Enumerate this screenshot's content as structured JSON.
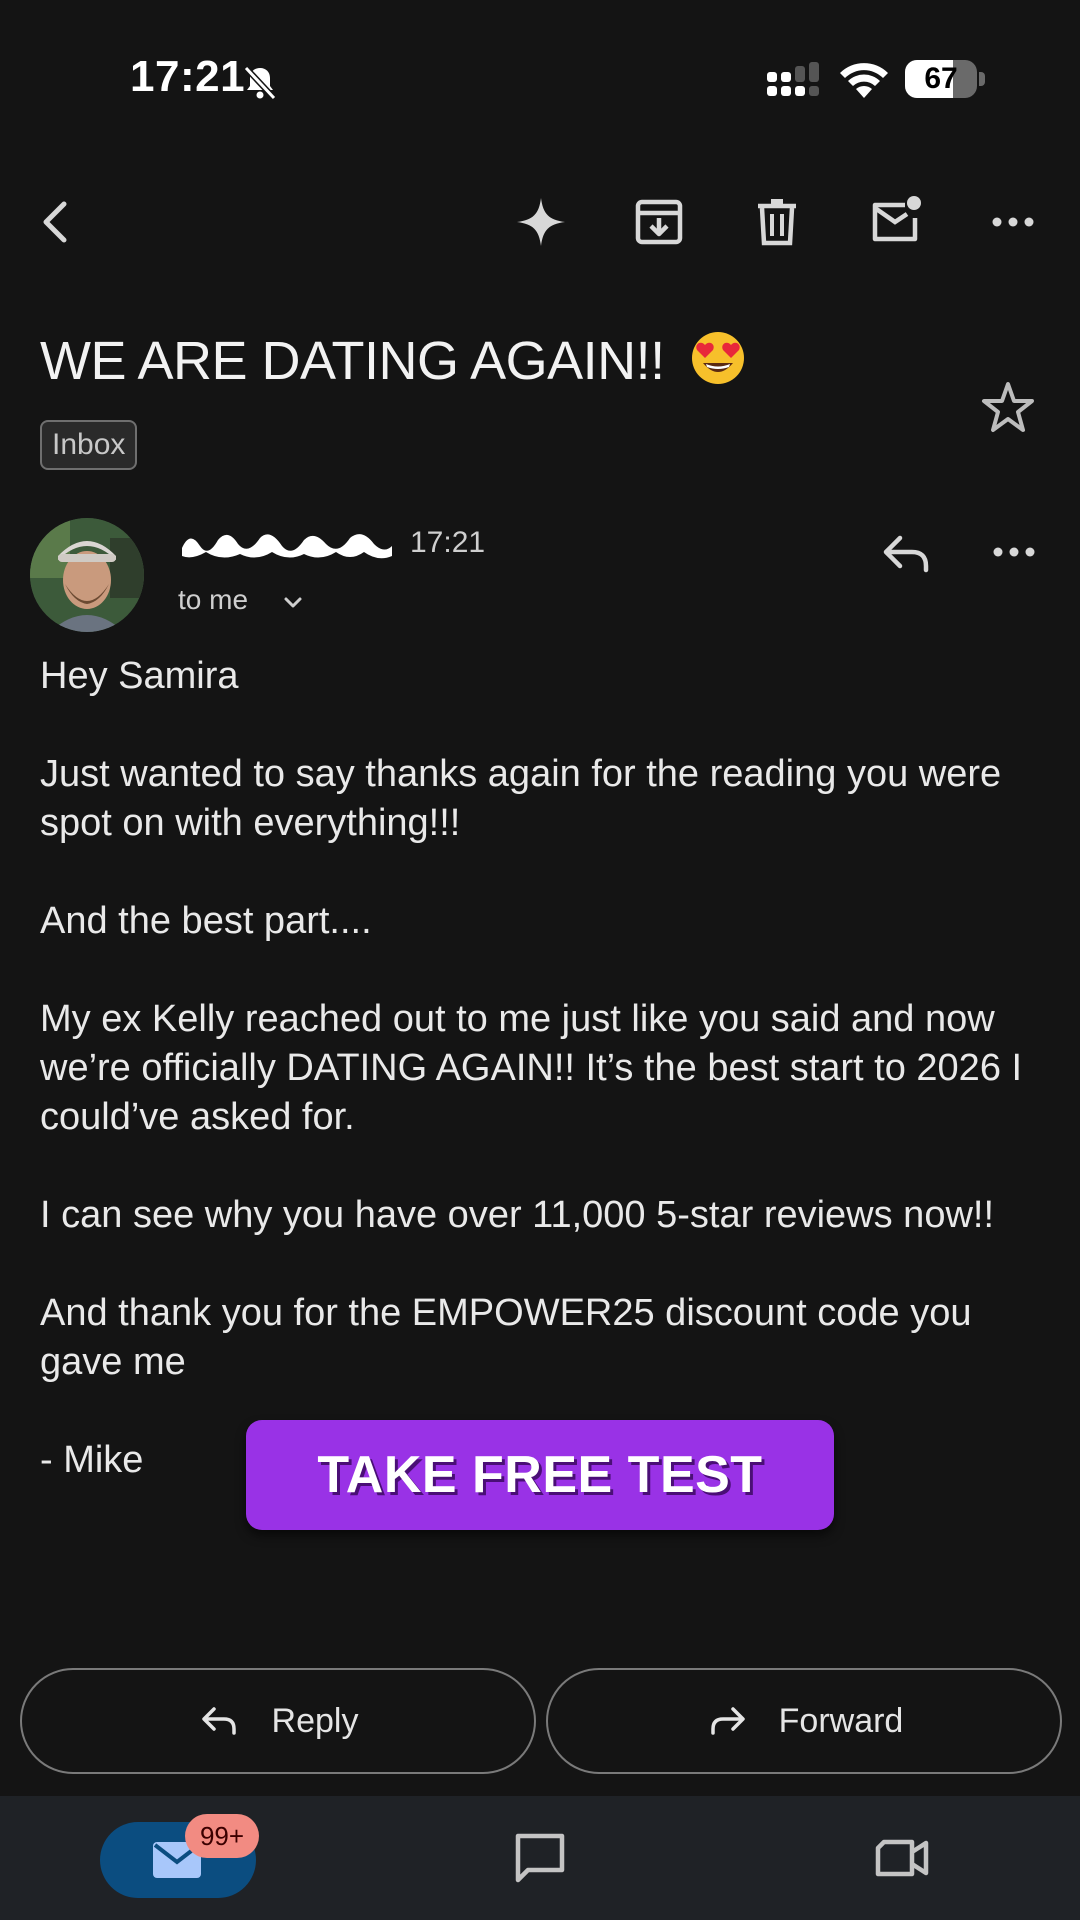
{
  "status_bar": {
    "time": "17:21",
    "battery": "67",
    "battery_level": 0.67
  },
  "toolbar": {
    "icons": [
      "back-arrow-icon",
      "gemini-sparkle-icon",
      "archive-icon",
      "delete-icon",
      "mark-unread-icon",
      "more-icon"
    ]
  },
  "email": {
    "subject": "WE ARE DATING AGAIN!!",
    "subject_emoji": "😍",
    "label": "Inbox",
    "sender_time": "17:21",
    "recipient": "to me",
    "body": [
      "Hey Samira",
      "Just wanted to say thanks again for the reading you were spot on with everything!!!",
      "And the best part....",
      "My ex Kelly reached out to me just like you said and now we’re officially DATING AGAIN!! It’s the best start to 2026 I could’ve asked for.",
      "I can see why you have over 11,000 5-star reviews now!!",
      "And thank you for the EMPOWER25 discount code you gave me",
      "- Mike"
    ]
  },
  "cta": {
    "label": "TAKE FREE TEST",
    "color": "#9932e6"
  },
  "actions": {
    "reply": "Reply",
    "forward": "Forward"
  },
  "bottom_nav": {
    "mail_badge": "99+",
    "accent": "#0b4d80"
  }
}
